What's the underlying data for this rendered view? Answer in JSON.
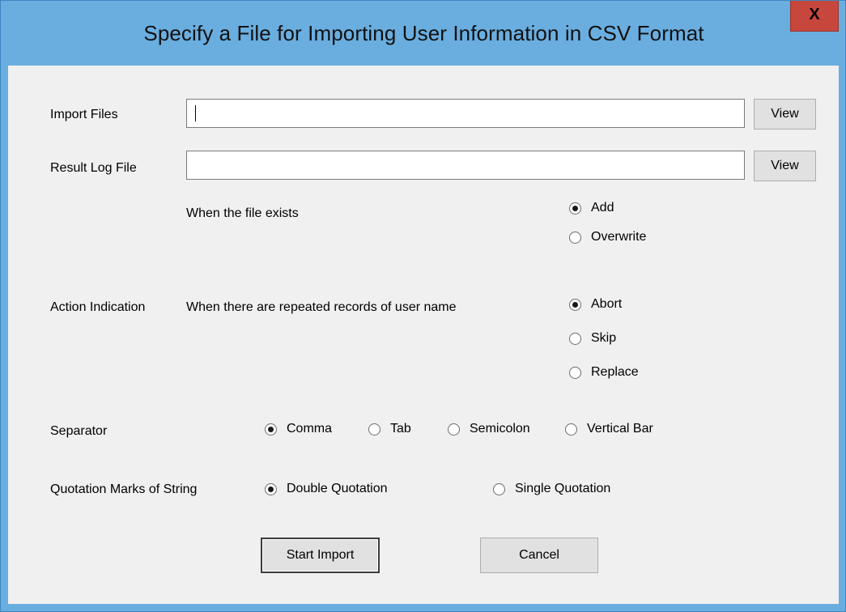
{
  "window": {
    "title": "Specify a File for Importing User Information in CSV Format",
    "close_label": "X"
  },
  "import_files": {
    "label": "Import Files",
    "value": "",
    "view_label": "View"
  },
  "result_log": {
    "label": "Result Log File",
    "value": "",
    "view_label": "View",
    "exists_label": "When the file exists",
    "options": [
      "Add",
      "Overwrite"
    ],
    "selected": "Add"
  },
  "action": {
    "label": "Action Indication",
    "sublabel": "When there are repeated records of user name",
    "options": [
      "Abort",
      "Skip",
      "Replace"
    ],
    "selected": "Abort"
  },
  "separator": {
    "label": "Separator",
    "options": [
      "Comma",
      "Tab",
      "Semicolon",
      "Vertical Bar"
    ],
    "selected": "Comma"
  },
  "quotation": {
    "label": "Quotation Marks of String",
    "options": [
      "Double Quotation",
      "Single Quotation"
    ],
    "selected": "Double Quotation"
  },
  "buttons": {
    "start": "Start Import",
    "cancel": "Cancel"
  }
}
